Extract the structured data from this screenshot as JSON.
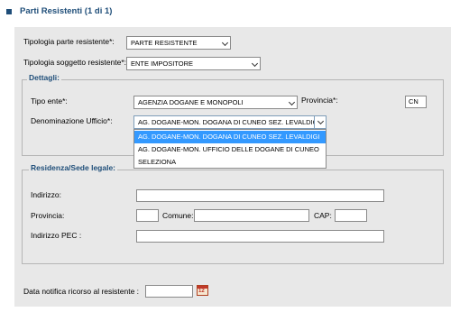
{
  "header": {
    "title": "Parti Resistenti (1 di 1)"
  },
  "form": {
    "tipologia_parte": {
      "label": "Tipologia parte resistente*:",
      "value": "PARTE RESISTENTE"
    },
    "tipologia_soggetto": {
      "label": "Tipologia soggetto resistente*:",
      "value": "ENTE IMPOSITORE"
    },
    "dettagli": {
      "legend": "Dettagli:",
      "tipo_ente": {
        "label": "Tipo ente*:",
        "value": "AGENZIA DOGANE E MONOPOLI"
      },
      "provincia": {
        "label": "Provincia*:",
        "value": "CN"
      },
      "denominazione": {
        "label": "Denominazione Ufficio*:",
        "value": "AG. DOGANE-MON. DOGANA DI CUNEO SEZ. LEVALDIGI",
        "options": [
          "AG. DOGANE-MON. DOGANA DI CUNEO SEZ. LEVALDIGI",
          "AG. DOGANE-MON. UFFICIO DELLE DOGANE DI CUNEO",
          "SELEZIONA"
        ]
      }
    },
    "residenza": {
      "legend": "Residenza/Sede legale:",
      "indirizzo": {
        "label": "Indirizzo:",
        "value": ""
      },
      "provincia": {
        "label": "Provincia:",
        "value": ""
      },
      "comune": {
        "label": "Comune:",
        "value": ""
      },
      "cap": {
        "label": "CAP:",
        "value": ""
      },
      "pec": {
        "label": "Indirizzo PEC :",
        "value": ""
      }
    },
    "data_notifica": {
      "label": "Data notifica ricorso al resistente :",
      "value": "",
      "icon": "calendar-icon",
      "icon_text": "12"
    }
  },
  "colors": {
    "accent": "#1f4e79",
    "panel": "#e8e8e8",
    "highlight": "#3399ff"
  }
}
